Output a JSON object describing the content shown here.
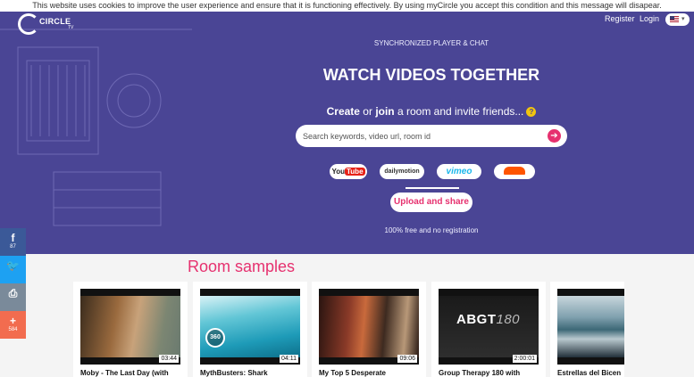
{
  "cookie_notice": "This website uses cookies to improve the user experience and ensure that it is functioning effectively. By using myCircle you accept this condition and this message will disapear.",
  "logo": {
    "text": "CIRCLE",
    "sub": "TV"
  },
  "nav": {
    "register": "Register",
    "login": "Login",
    "language_icon": "us-flag-icon"
  },
  "hero": {
    "tagline": "SYNCHRONIZED PLAYER & CHAT",
    "headline": "WATCH VIDEOS TOGETHER",
    "sub_create": "Create",
    "sub_or": " or ",
    "sub_join": "join",
    "sub_rest": " a room and invite friends...",
    "help_icon": "?",
    "search_placeholder": "Search keywords, video url, room id",
    "search_go_icon": "➔",
    "providers": {
      "youtube_a": "You",
      "youtube_b": "Tube",
      "dailymotion": "dailymotion",
      "vimeo": "vimeo",
      "soundcloud": "soundcloud"
    },
    "upload_label": "Upload and share",
    "free_note": "100% free and no registration"
  },
  "share": {
    "facebook": {
      "glyph": "f",
      "count": "87"
    },
    "twitter": {
      "glyph": "🐦",
      "count": ""
    },
    "print": {
      "glyph": "⎙",
      "count": ""
    },
    "more": {
      "glyph": "+",
      "count": "584"
    }
  },
  "rooms": {
    "title": "Room samples",
    "items": [
      {
        "title": "Moby - The Last Day (with",
        "duration": "03:44"
      },
      {
        "title": "MythBusters: Shark",
        "duration": "04:11",
        "badge": "360"
      },
      {
        "title": "My Top 5 Desperate",
        "duration": "09:06"
      },
      {
        "title": "Group Therapy 180 with",
        "duration": "2:00:01",
        "overlay_a": "ABGT",
        "overlay_b": "180"
      },
      {
        "title": "Estrellas del Bicen",
        "duration": ""
      }
    ]
  },
  "colors": {
    "hero_bg": "#4a4595",
    "accent": "#e6316f"
  }
}
